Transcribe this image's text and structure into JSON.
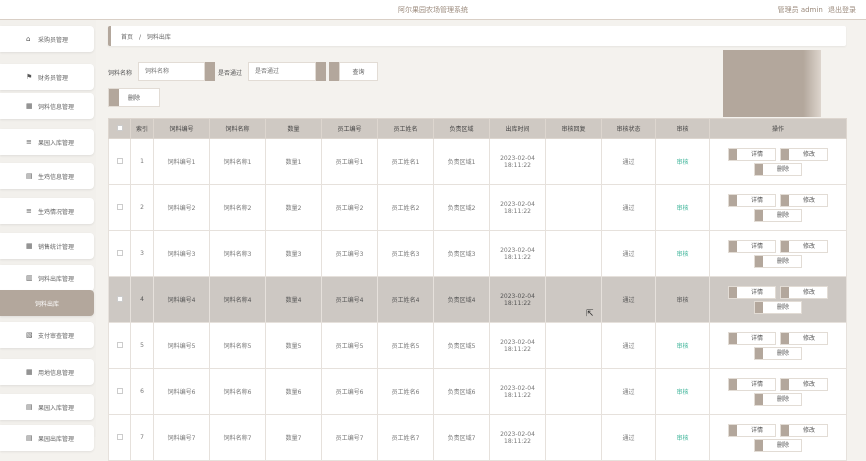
{
  "header": {
    "title": "阿尔果园农场管理系统",
    "user_label": "管理员 admin",
    "logout_label": "退出登录"
  },
  "sidebar": {
    "items": [
      {
        "label": "采购员管理",
        "icon": "home-icon",
        "glyph": "⌂"
      },
      {
        "label": "财务员管理",
        "icon": "flag-icon",
        "glyph": "⚑"
      },
      {
        "label": "饲料信息管理",
        "icon": "grid-icon",
        "glyph": "▦"
      },
      {
        "label": "果园入库管理",
        "icon": "list-icon",
        "glyph": "≡"
      },
      {
        "label": "生鸡信息管理",
        "icon": "box-icon",
        "glyph": "▤"
      },
      {
        "label": "生鸡情况管理",
        "icon": "list-icon",
        "glyph": "≡"
      },
      {
        "label": "销售统计管理",
        "icon": "grid-icon",
        "glyph": "▦"
      },
      {
        "label": "饲料出库管理",
        "icon": "chart-icon",
        "glyph": "▥"
      },
      {
        "label": "饲料出库",
        "icon": "",
        "glyph": ""
      },
      {
        "label": "支付审查管理",
        "icon": "doc-icon",
        "glyph": "▧"
      },
      {
        "label": "用地信息管理",
        "icon": "table-icon",
        "glyph": "▦"
      },
      {
        "label": "果园入库管理",
        "icon": "box-icon",
        "glyph": "▤"
      },
      {
        "label": "果园出库管理",
        "icon": "box-icon",
        "glyph": "▤"
      }
    ]
  },
  "breadcrumb": {
    "home": "首页",
    "sep": "/",
    "current": "饲料出库"
  },
  "search": {
    "name_label": "饲料名称",
    "name_placeholder": "饲料名称",
    "status_label": "是否通过",
    "status_placeholder": "是否通过",
    "query_label": "查询"
  },
  "delete_label": "删除",
  "table": {
    "columns": [
      "索引",
      "饲料编号",
      "饲料名称",
      "数量",
      "员工编号",
      "员工姓名",
      "负责区域",
      "出库时间",
      "审核回复",
      "审核状态",
      "审核",
      "操作"
    ],
    "rows": [
      {
        "index": "1",
        "code": "饲料编号1",
        "name": "饲料名称1",
        "qty": "数量1",
        "emp_code": "员工编号1",
        "emp_name": "员工姓名1",
        "area": "负责区域1",
        "time": "2023-02-04 18:11:22",
        "reply": "",
        "status": "通过",
        "audit": "审核"
      },
      {
        "index": "2",
        "code": "饲料编号2",
        "name": "饲料名称2",
        "qty": "数量2",
        "emp_code": "员工编号2",
        "emp_name": "员工姓名2",
        "area": "负责区域2",
        "time": "2023-02-04 18:11:22",
        "reply": "",
        "status": "通过",
        "audit": "审核"
      },
      {
        "index": "3",
        "code": "饲料编号3",
        "name": "饲料名称3",
        "qty": "数量3",
        "emp_code": "员工编号3",
        "emp_name": "员工姓名3",
        "area": "负责区域3",
        "time": "2023-02-04 18:11:22",
        "reply": "",
        "status": "通过",
        "audit": "审核"
      },
      {
        "index": "4",
        "code": "饲料编号4",
        "name": "饲料名称4",
        "qty": "数量4",
        "emp_code": "员工编号4",
        "emp_name": "员工姓名4",
        "area": "负责区域4",
        "time": "2023-02-04 18:11:22",
        "reply": "",
        "status": "通过",
        "audit": "审核"
      },
      {
        "index": "5",
        "code": "饲料编号5",
        "name": "饲料名称5",
        "qty": "数量5",
        "emp_code": "员工编号5",
        "emp_name": "员工姓名5",
        "area": "负责区域5",
        "time": "2023-02-04 18:11:22",
        "reply": "",
        "status": "通过",
        "audit": "审核"
      },
      {
        "index": "6",
        "code": "饲料编号6",
        "name": "饲料名称6",
        "qty": "数量6",
        "emp_code": "员工编号6",
        "emp_name": "员工姓名6",
        "area": "负责区域6",
        "time": "2023-02-04 18:11:22",
        "reply": "",
        "status": "通过",
        "audit": "审核"
      },
      {
        "index": "7",
        "code": "饲料编号7",
        "name": "饲料名称7",
        "qty": "数量7",
        "emp_code": "员工编号7",
        "emp_name": "员工姓名7",
        "area": "负责区域7",
        "time": "2023-02-04 18:11:22",
        "reply": "",
        "status": "通过",
        "audit": "审核"
      }
    ],
    "actions": {
      "detail": "详情",
      "edit": "修改",
      "delete": "删除"
    }
  },
  "colors": {
    "accent": "#b3a79c",
    "highlight_row": "#cdc8c3",
    "audit_link": "#3fb59a",
    "header_row": "#cfc9c3"
  }
}
